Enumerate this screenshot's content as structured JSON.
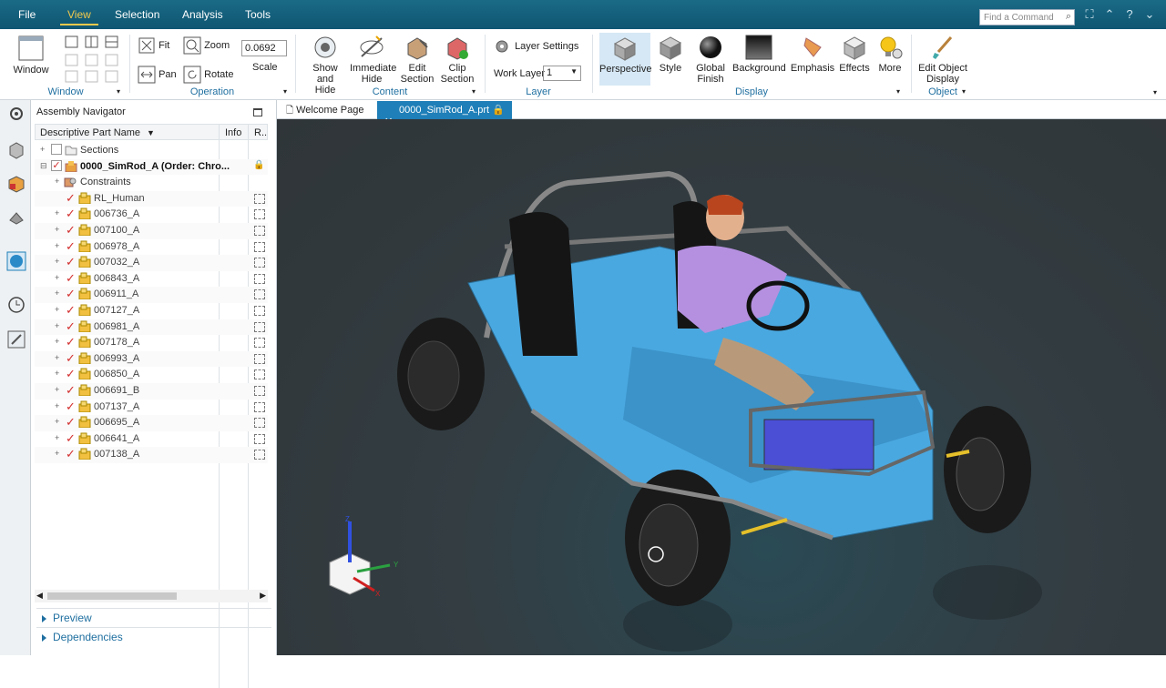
{
  "menubar": {
    "items": [
      "File",
      "View",
      "Selection",
      "Analysis",
      "Tools"
    ],
    "active": "View",
    "find_placeholder": "Find a Command"
  },
  "ribbon": {
    "window": {
      "label": "Window",
      "group": "Window"
    },
    "operation": {
      "fit": "Fit",
      "zoom": "Zoom",
      "pan": "Pan",
      "rotate": "Rotate",
      "scale_value": "0.0692",
      "scale_label": "Scale",
      "group": "Operation"
    },
    "content": {
      "show_hide": "Show and Hide",
      "immediate_hide": "Immediate Hide",
      "edit_section": "Edit Section",
      "clip_section": "Clip Section",
      "group": "Content"
    },
    "layer": {
      "layer_settings": "Layer Settings",
      "work_layer_label": "Work Layer",
      "work_layer_value": "1",
      "group": "Layer"
    },
    "display": {
      "perspective": "Perspective",
      "style": "Style",
      "global_finish": "Global Finish",
      "background": "Background",
      "emphasis": "Emphasis",
      "effects": "Effects",
      "more": "More",
      "group": "Display"
    },
    "object": {
      "edit_object_display": "Edit Object Display",
      "group": "Object"
    }
  },
  "tabs": [
    {
      "label": "Welcome Page"
    },
    {
      "label": "0000_SimRod_A.prt"
    }
  ],
  "navigator": {
    "title": "Assembly Navigator",
    "columns": {
      "name": "Descriptive Part Name",
      "info": "Info",
      "r": "R.."
    },
    "rows": [
      {
        "label": "Sections"
      },
      {
        "label": "0000_SimRod_A (Order: Chro..."
      },
      {
        "label": "Constraints"
      },
      {
        "label": "RL_Human"
      },
      {
        "label": "006736_A"
      },
      {
        "label": "007100_A"
      },
      {
        "label": "006978_A"
      },
      {
        "label": "007032_A"
      },
      {
        "label": "006843_A"
      },
      {
        "label": "006911_A"
      },
      {
        "label": "007127_A"
      },
      {
        "label": "006981_A"
      },
      {
        "label": "007178_A"
      },
      {
        "label": "006993_A"
      },
      {
        "label": "006850_A"
      },
      {
        "label": "006691_B"
      },
      {
        "label": "007137_A"
      },
      {
        "label": "006695_A"
      },
      {
        "label": "006641_A"
      },
      {
        "label": "007138_A"
      }
    ],
    "sections": {
      "preview": "Preview",
      "dependencies": "Dependencies"
    }
  },
  "triad": {
    "x": "X",
    "y": "Y",
    "z": "Z"
  },
  "colors": {
    "accent": "#1f7fb8",
    "menubar": "#0f5672",
    "car_body": "#4aa8e0",
    "check": "#d32f2f"
  }
}
